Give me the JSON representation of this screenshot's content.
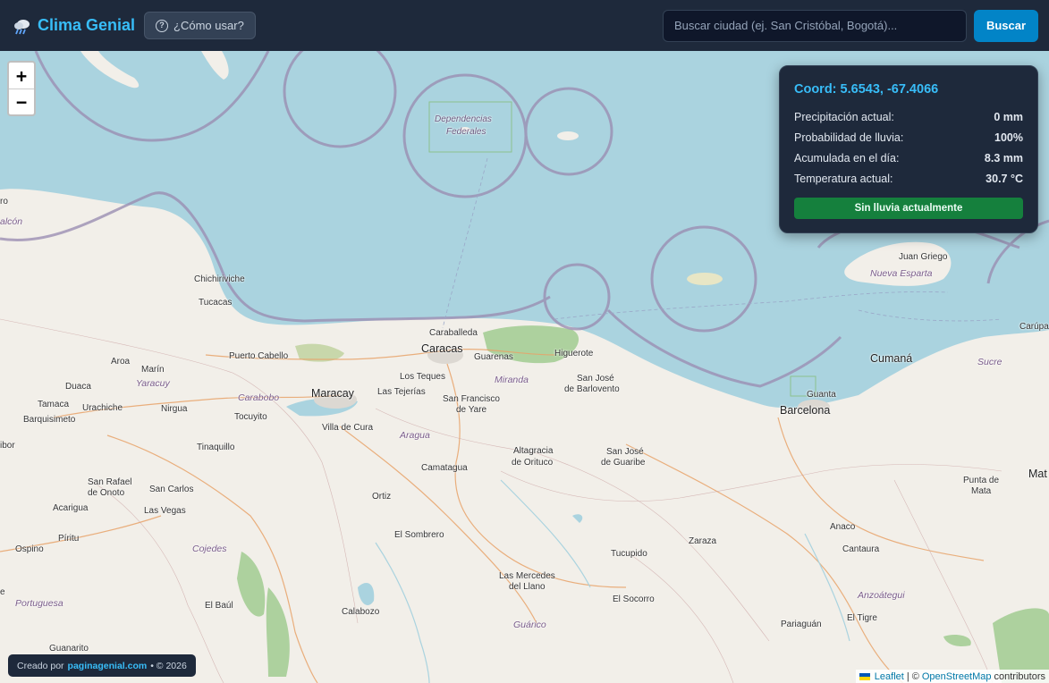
{
  "header": {
    "app_title": "Clima Genial",
    "app_icon": "rain-cloud-icon",
    "help_label": "¿Cómo usar?",
    "search_placeholder": "Buscar ciudad (ej. San Cristóbal, Bogotá)...",
    "search_value": "",
    "search_button": "Buscar"
  },
  "zoom": {
    "in": "+",
    "out": "−"
  },
  "info_panel": {
    "title": "Coord: 5.6543, -67.4066",
    "rows": [
      {
        "label": "Precipitación actual:",
        "value": "0 mm"
      },
      {
        "label": "Probabilidad de lluvia:",
        "value": "100%"
      },
      {
        "label": "Acumulada en el día:",
        "value": "8.3 mm"
      },
      {
        "label": "Temperatura actual:",
        "value": "30.7 °C"
      }
    ],
    "status": "Sin lluvia actualmente"
  },
  "footer": {
    "credit_prefix": "Creado por",
    "credit_link": "paginagenial.com",
    "credit_suffix": "• © 2026",
    "attrib_leaflet": "Leaflet",
    "attrib_sep": "| ©",
    "attrib_osm": "OpenStreetMap",
    "attrib_suffix": "contributors"
  },
  "colors": {
    "header_bg": "#1e293b",
    "accent": "#38bdf8",
    "button": "#0284c7",
    "status_green": "#15803d",
    "sea": "#aad3df",
    "land": "#f2efe9"
  },
  "map_labels": {
    "dependencias": "Dependencias",
    "federales": "Federales",
    "juan_griego": "Juan Griego",
    "nueva_esparta": "Nueva Esparta",
    "chichiriviche": "Chichiriviche",
    "tucacas": "Tucacas",
    "falcon": "alcón",
    "ro": "ro",
    "caraballeda": "Caraballeda",
    "caracas": "Caracas",
    "guarenas": "Guarenas",
    "higuerote": "Higuerote",
    "puerto_cabello": "Puerto Cabello",
    "aroa": "Aroa",
    "marin": "Marín",
    "yaracuy": "Yaracuy",
    "duaca": "Duaca",
    "carabobo": "Carabobo",
    "maracay": "Maracay",
    "las_tejerias": "Las Tejerías",
    "los_teques": "Los Teques",
    "miranda": "Miranda",
    "san_jose_barlovento_1": "San José",
    "san_jose_barlovento_2": "de Barlovento",
    "cumana": "Cumaná",
    "sucre": "Sucre",
    "carupa": "Carúpa",
    "guanta": "Guanta",
    "barcelona": "Barcelona",
    "tamaca": "Tamaca",
    "urachiche": "Urachiche",
    "nirgua": "Nirgua",
    "barquisimeto": "Barquisimeto",
    "tocuyito": "Tocuyito",
    "san_francisco_1": "San Francisco",
    "san_francisco_2": "de Yare",
    "ibor": "ibor",
    "villa_de_cura": "Villa de Cura",
    "aragua": "Aragua",
    "tinaquillo": "Tinaquillo",
    "altagracia_1": "Altagracia",
    "altagracia_2": "de Orituco",
    "san_jose_guaribe_1": "San José",
    "san_jose_guaribe_2": "de Guaribe",
    "camatagua": "Camatagua",
    "san_rafael_1": "San Rafael",
    "san_rafael_2": "de Onoto",
    "san_carlos": "San Carlos",
    "punta_de_mata_1": "Punta de",
    "punta_de_mata_2": "Mata",
    "mat": "Mat",
    "acarigua": "Acarigua",
    "las_vegas": "Las Vegas",
    "ortiz": "Ortiz",
    "piritu": "Píritu",
    "el_sombrero": "El Sombrero",
    "anaco": "Anaco",
    "zaraza": "Zaraza",
    "ospino": "Ospino",
    "cojedes": "Cojedes",
    "tucupido": "Tucupido",
    "cantaura": "Cantaura",
    "las_mercedes_1": "Las Mercedes",
    "las_mercedes_2": "del Llano",
    "portuguesa": "Portuguesa",
    "el_baul": "El Baúl",
    "el_socorro": "El Socorro",
    "anzoategui": "Anzoátegui",
    "calabozo": "Calabozo",
    "el_tigre": "El Tigre",
    "guarico": "Guárico",
    "pariaguan": "Pariaguán",
    "guanarito": "Guanarito",
    "e": "e"
  }
}
